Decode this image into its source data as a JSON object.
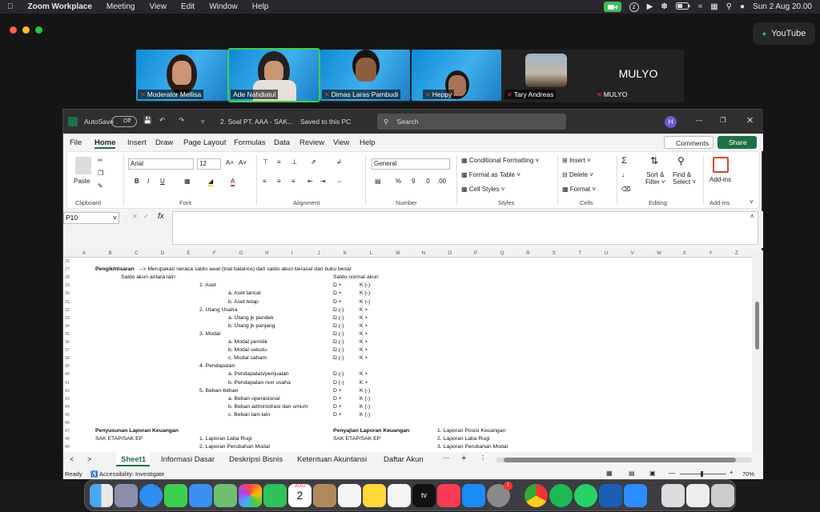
{
  "menubar": {
    "app": "Zoom Workplace",
    "items": [
      "Meeting",
      "View",
      "Edit",
      "Window",
      "Help"
    ],
    "clock": "Sun 2 Aug  20.00"
  },
  "youtube": {
    "label": "YouTube"
  },
  "participants": [
    {
      "name": "Moderator Mellisa"
    },
    {
      "name": "Ade Nahdiatul"
    },
    {
      "name": "Dimas Laras Pambudi"
    },
    {
      "name": "Heppy"
    },
    {
      "name": "Tary Andreas"
    },
    {
      "name": "MULYO",
      "big": "MULYO"
    }
  ],
  "excel": {
    "autosave": "AutoSave",
    "autosave_state": "Off",
    "doc_title": "2. Soal PT. AAA - SAK...",
    "saved": "Saved to this PC",
    "search_placeholder": "Search",
    "avatar": "H",
    "tabs": [
      "File",
      "Home",
      "Insert",
      "Draw",
      "Page Layout",
      "Formulas",
      "Data",
      "Review",
      "View",
      "Help"
    ],
    "comments": "Comments",
    "share": "Share",
    "ribbon": {
      "paste": "Paste",
      "clipboard": "Clipboard",
      "font_name": "Arial",
      "font_size": "12",
      "font": "Font",
      "alignment": "Alignment",
      "number_format": "General",
      "number": "Number",
      "cond_format": "Conditional Formatting",
      "format_table": "Format as Table",
      "cell_styles": "Cell Styles",
      "styles": "Styles",
      "insert": "Insert",
      "delete": "Delete",
      "format": "Format",
      "cells": "Cells",
      "sort_filter": "Sort &",
      "sort_filter2": "Filter",
      "find_select": "Find &",
      "find_select2": "Select",
      "editing": "Editing",
      "addins": "Add-ins",
      "addins_grp": "Add-ins"
    },
    "name_box": "P10",
    "fx": "fx",
    "columns": [
      "A",
      "B",
      "C",
      "D",
      "E",
      "F",
      "G",
      "H",
      "I",
      "J",
      "K",
      "L",
      "M",
      "N",
      "O",
      "P",
      "Q",
      "R",
      "S",
      "T",
      "U",
      "V",
      "W",
      "X",
      "Y",
      "Z"
    ],
    "rows": [
      "26",
      "27",
      "28",
      "29",
      "30",
      "31",
      "32",
      "33",
      "34",
      "35",
      "36",
      "37",
      "38",
      "39",
      "40",
      "41",
      "42",
      "43",
      "44",
      "45",
      "46",
      "47",
      "48",
      "49"
    ],
    "cells": {
      "r27a": "Pengikhtisaran",
      "r27b": " --> Merupakan neraca saldo awal (trial balance) dari saldo akun berasal dari buku besar",
      "r28a": "Saldo akun antara lain:",
      "r28b": "Saldo normal akun",
      "r29": "1. Aset",
      "r29d": "D +",
      "r29k": "K (-)",
      "r30": "a. Aset lancar",
      "r30d": "D +",
      "r30k": "K (-)",
      "r31": "b. Aset tetap",
      "r31d": "D +",
      "r31k": "K (-)",
      "r32": "2. Utang Usaha",
      "r32d": "D (-)",
      "r32k": "K +",
      "r33": "a. Utang jk pendek",
      "r33d": "D (-)",
      "r33k": "K +",
      "r34": "b. Utang jk panjang",
      "r34d": "D (-)",
      "r34k": "K +",
      "r35": "3. Modal",
      "r35d": "D (-)",
      "r35k": "K +",
      "r36": "a. Modal pemilik",
      "r36d": "D (-)",
      "r36k": "K +",
      "r37": "b. Modal sekutu",
      "r37d": "D (-)",
      "r37k": "K +",
      "r38": "c. Modal saham",
      "r38d": "D (-)",
      "r38k": "K +",
      "r39": "4. Pendapatan",
      "r40": "a. Pendapatan/penjualan",
      "r40d": "D (-)",
      "r40k": "K +",
      "r41": "b. Pendapatan non usaha",
      "r41d": "D (-)",
      "r41k": "K +",
      "r42": "5. Beban-beban",
      "r42d": "D +",
      "r42k": "K (-)",
      "r43": "a. Beban operasional",
      "r43d": "D +",
      "r43k": "K (-)",
      "r44": "b. Beban administrasi dan umum",
      "r44d": "D +",
      "r44k": "K (-)",
      "r45": "c. Beban lain-lain",
      "r45d": "D +",
      "r45k": "K (-)",
      "r47a": "Penyusunan Laporan Keuangan",
      "r47b": "Penyajian Laporan Keuangan",
      "r47c": "1. Laporan Posisi Keuangan",
      "r48a": "SAK ETAP/SAK EP",
      "r48b": "1. Laporan Laba Rugi",
      "r48c": "SAK ETAP/SAK EP",
      "r48d": "2. Laporan Laba Rugi",
      "r49a": "2. Laporan Perubahan Modal",
      "r49b": "3. Laporan Perubahan Modal"
    },
    "sheet_tabs": [
      "Sheet1",
      "Informasi Dasar",
      "Deskripsi Bisnis",
      "Ketentuan Akuntansi",
      "Daftar Akun"
    ],
    "status": {
      "ready": "Ready",
      "accessibility": "Accessibility: Investigate",
      "zoom": "70%"
    }
  },
  "dock": {
    "calendar_month": "AUG",
    "calendar_day": "2",
    "tv": "tv",
    "badge": "1"
  }
}
